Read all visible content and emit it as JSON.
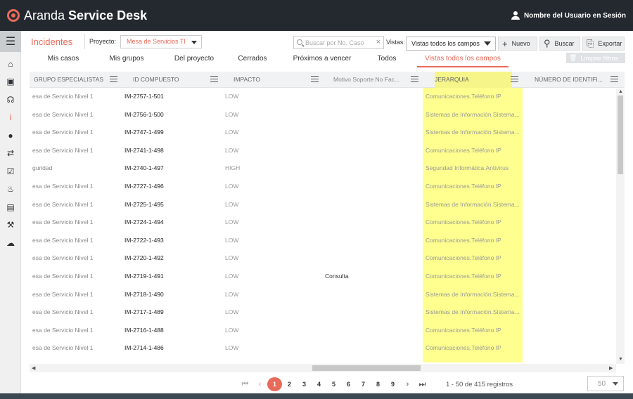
{
  "app": {
    "brand_light": "Aranda",
    "brand_bold": "Service Desk",
    "user": "Nombre del Usuario en Sesión"
  },
  "sidebar": {
    "icons": [
      "menu-icon",
      "home-icon",
      "save-icon",
      "headset-icon",
      "incident-icon",
      "drop-icon",
      "refresh-icon",
      "checklist-icon",
      "alarm-icon",
      "book-icon",
      "tools-icon",
      "chat-icon"
    ]
  },
  "header": {
    "title": "Incidentes",
    "project_label": "Proyecto:",
    "project_value": "Mesa de Servicios TI",
    "search_placeholder": "Buscar por No. Caso",
    "views_label": "Vistas:",
    "views_value": "Vistas todos los campos",
    "new": "Nuevo",
    "search": "Buscar",
    "export": "Exportar"
  },
  "tabs": [
    "Mis casos",
    "Mis grupos",
    "Del proyecto",
    "Cerrados",
    "Próximos a vencer",
    "Todos",
    "Vistas todos los campos"
  ],
  "clear_filters": "Limpiar filtros",
  "columns": [
    "GRUPO ESPECIALISTAS",
    "ID COMPUESTO",
    "IMPACTO",
    "Motivo Soporte No Fac...",
    "JERARQUIA",
    "NÚMERO DE IDENTIFI..."
  ],
  "rows": [
    [
      "esa de Servicio Nivel 1",
      "IM-2757-1-501",
      "LOW",
      "",
      "Comunicaciones.Teléfono IP"
    ],
    [
      "esa de Servicio Nivel 1",
      "IM-2756-1-500",
      "LOW",
      "",
      "Sistemas de Información.Sistema..."
    ],
    [
      "esa de Servicio Nivel 1",
      "IM-2747-1-499",
      "LOW",
      "",
      "Sistemas de Información.Sistema..."
    ],
    [
      "esa de Servicio Nivel 1",
      "IM-2741-1-498",
      "LOW",
      "",
      "Comunicaciones.Teléfono IP"
    ],
    [
      "guridad",
      "IM-2740-1-497",
      "HIGH",
      "",
      "Seguridad Informática.Antivirus"
    ],
    [
      "esa de Servicio Nivel 1",
      "IM-2727-1-496",
      "LOW",
      "",
      "Comunicaciones.Teléfono IP"
    ],
    [
      "esa de Servicio Nivel 1",
      "IM-2725-1-495",
      "LOW",
      "",
      "Sistemas de Información.Sistema..."
    ],
    [
      "esa de Servicio Nivel 1",
      "IM-2724-1-494",
      "LOW",
      "",
      "Comunicaciones.Teléfono IP"
    ],
    [
      "esa de Servicio Nivel 1",
      "IM-2722-1-493",
      "LOW",
      "",
      "Comunicaciones.Teléfono IP"
    ],
    [
      "esa de Servicio Nivel 1",
      "IM-2720-1-492",
      "LOW",
      "",
      "Comunicaciones.Teléfono IP"
    ],
    [
      "esa de Servicio Nivel 1",
      "IM-2719-1-491",
      "LOW",
      "Consulta",
      "Comunicaciones.Teléfono IP"
    ],
    [
      "esa de Servicio Nivel 1",
      "IM-2718-1-490",
      "LOW",
      "",
      "Sistemas de Información.Sistema..."
    ],
    [
      "esa de Servicio Nivel 1",
      "IM-2717-1-489",
      "LOW",
      "",
      "Sistemas de Información.Sistema..."
    ],
    [
      "esa de Servicio Nivel 1",
      "IM-2716-1-488",
      "LOW",
      "",
      "Comunicaciones.Teléfono IP"
    ],
    [
      "esa de Servicio Nivel 1",
      "IM-2714-1-486",
      "LOW",
      "",
      "Comunicaciones.Teléfono IP"
    ]
  ],
  "pagination": {
    "pages": [
      "1",
      "2",
      "3",
      "4",
      "5",
      "6",
      "7",
      "8",
      "9"
    ],
    "current": "1",
    "summary": "1 - 50 de 415 registros",
    "per_page": "50"
  },
  "colors": {
    "accent": "#e86a5a",
    "highlight": "#ffff8f",
    "topbar": "#23292f"
  }
}
